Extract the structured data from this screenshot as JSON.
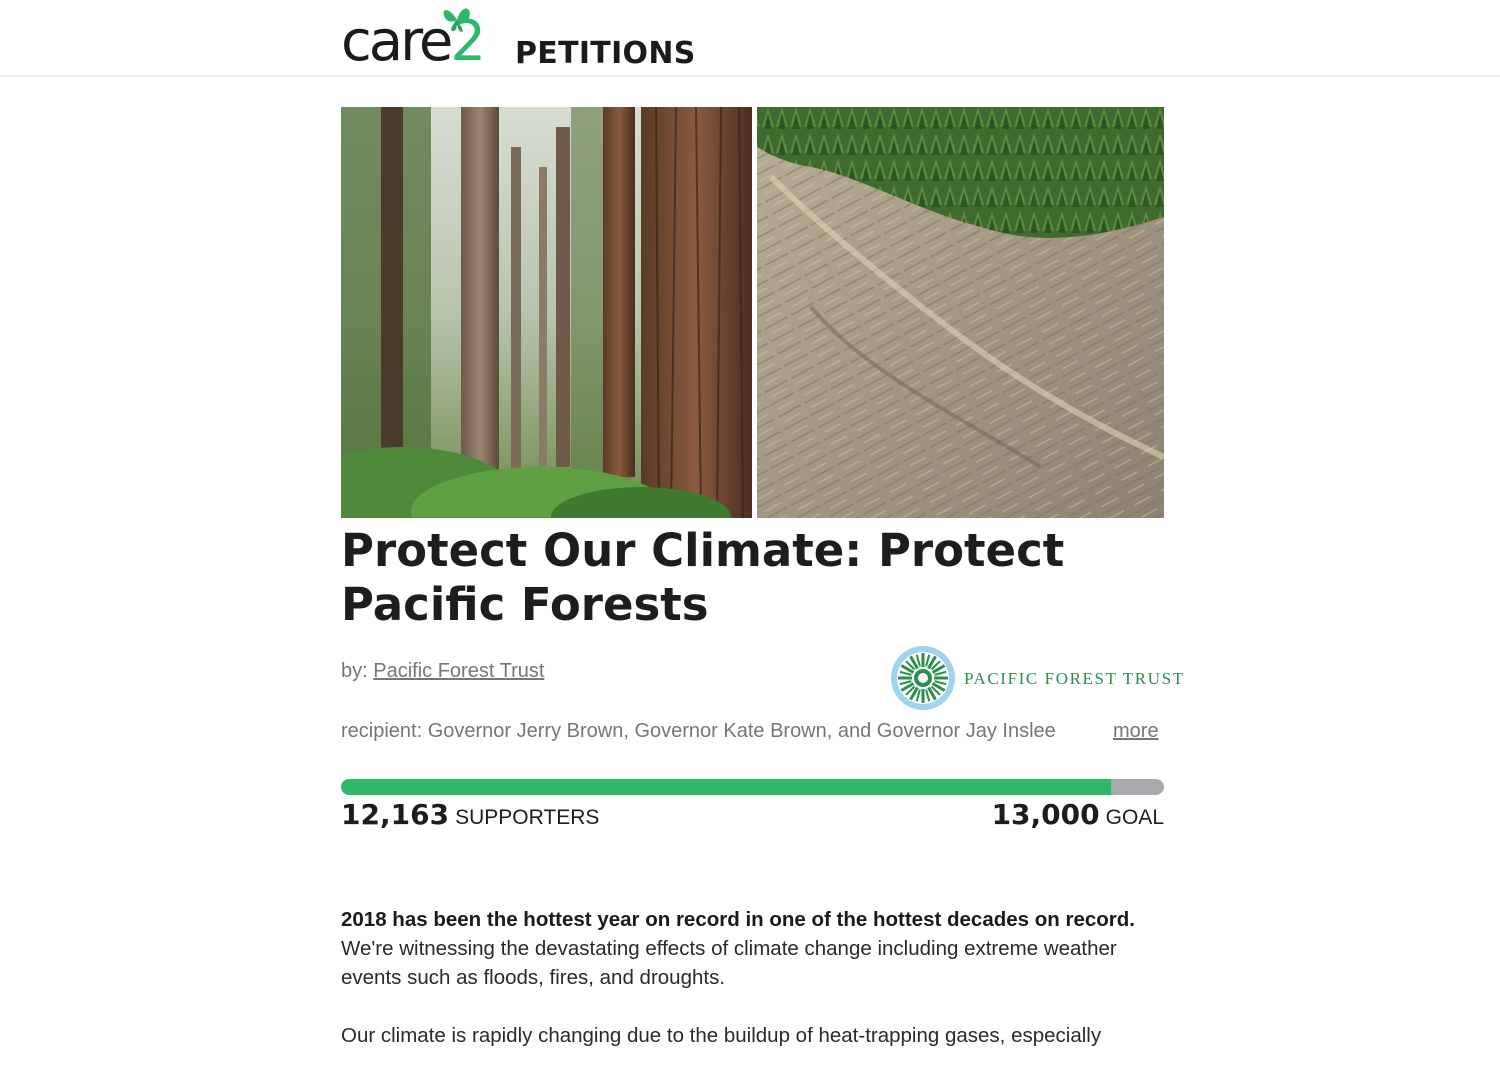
{
  "header": {
    "logo_word": "care",
    "logo_digit": "2",
    "logo_sub": "PETITIONS"
  },
  "petition": {
    "title": "Protect Our Climate: Protect Pacific Forests",
    "by_prefix": "by:",
    "author": "Pacific Forest Trust",
    "org_logo_text": "PACIFIC FOREST TRUST",
    "recipient": "recipient: Governor Jerry Brown, Governor Kate Brown, and Governor Jay Inslee",
    "more_label": "more"
  },
  "progress": {
    "supporters_count": "12,163",
    "supporters_label": "SUPPORTERS",
    "goal_count": "13,000",
    "goal_label": "GOAL",
    "fraction": 0.9357
  },
  "body": {
    "p1_bold": "2018 has been the hottest year on record in one of the hottest decades on record.",
    "p1_rest": "We're witnessing the devastating effects of climate change including extreme weather events such as floods, fires, and droughts.",
    "p2": "Our climate is rapidly changing due to the buildup of heat-trapping gases, especially"
  },
  "colors": {
    "brand_green": "#2eb86a",
    "progress_track": "#a8aaad",
    "org_green": "#2a8f4b"
  }
}
